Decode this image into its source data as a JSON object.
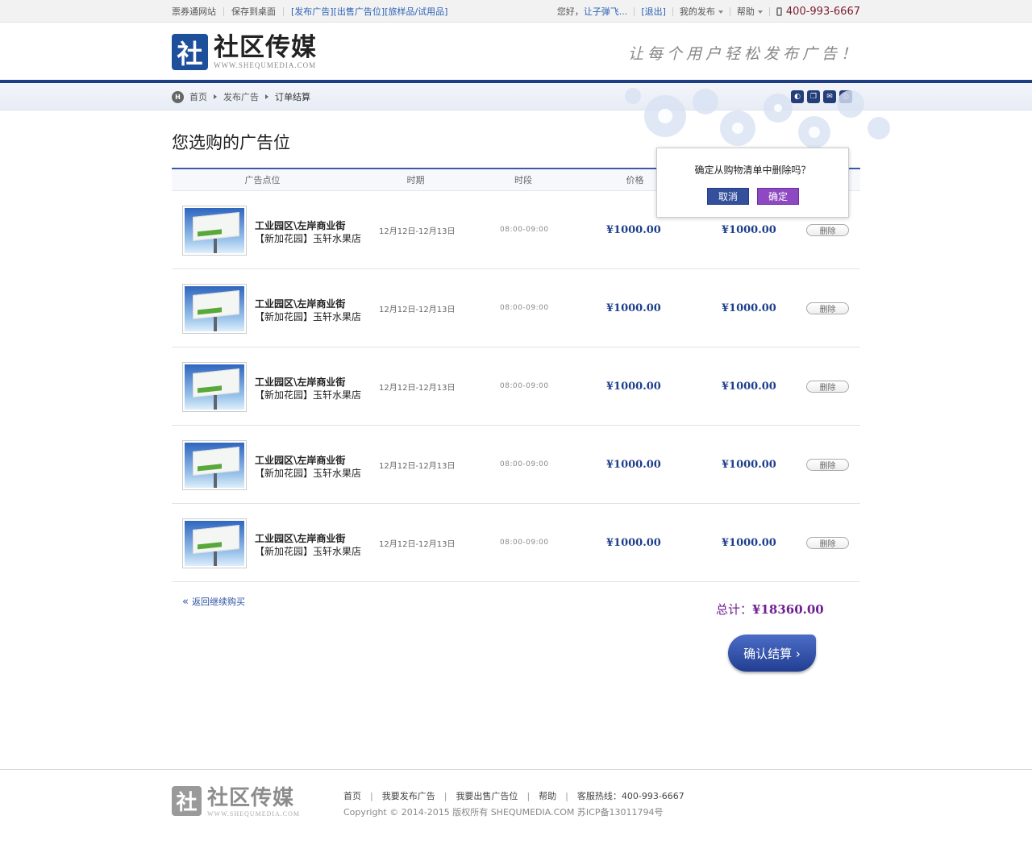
{
  "topbar": {
    "site_name": "票券通网站",
    "save_desktop": "保存到桌面",
    "links": [
      "[发布广告]",
      "[出售广告位]",
      "[旅样品/试用品]"
    ],
    "greeting": "您好，",
    "username": "让子弹飞...",
    "logout": "[退出]",
    "my_publish": "我的发布",
    "help": "帮助",
    "phone": "400-993-6667"
  },
  "header": {
    "logo_mark": "社",
    "logo_cn": "社区传媒",
    "logo_en": "WWW.SHEQUMEDIA.COM",
    "slogan": "让每个用户轻松发布广告！"
  },
  "breadcrumb": {
    "home_icon": "H",
    "items": [
      "首页",
      "发布广告",
      "订单结算"
    ],
    "share_icons": [
      "wechat-icon",
      "copy-icon",
      "mail-icon",
      "print-icon"
    ]
  },
  "page": {
    "title": "您选购的广告位"
  },
  "table": {
    "headers": [
      "广告点位",
      "时期",
      "时段",
      "价格"
    ],
    "rows": [
      {
        "name_line1": "工业园区\\左岸商业街",
        "name_line2": "【新加花园】玉轩水果店",
        "date": "12月12日-12月13日",
        "time": "08:00-09:00",
        "price": "¥1000.00",
        "subtotal": "¥1000.00",
        "delete": "删除"
      },
      {
        "name_line1": "工业园区\\左岸商业街",
        "name_line2": "【新加花园】玉轩水果店",
        "date": "12月12日-12月13日",
        "time": "08:00-09:00",
        "price": "¥1000.00",
        "subtotal": "¥1000.00",
        "delete": "删除"
      },
      {
        "name_line1": "工业园区\\左岸商业街",
        "name_line2": "【新加花园】玉轩水果店",
        "date": "12月12日-12月13日",
        "time": "08:00-09:00",
        "price": "¥1000.00",
        "subtotal": "¥1000.00",
        "delete": "删除"
      },
      {
        "name_line1": "工业园区\\左岸商业街",
        "name_line2": "【新加花园】玉轩水果店",
        "date": "12月12日-12月13日",
        "time": "08:00-09:00",
        "price": "¥1000.00",
        "subtotal": "¥1000.00",
        "delete": "删除"
      },
      {
        "name_line1": "工业园区\\左岸商业街",
        "name_line2": "【新加花园】玉轩水果店",
        "date": "12月12日-12月13日",
        "time": "08:00-09:00",
        "price": "¥1000.00",
        "subtotal": "¥1000.00",
        "delete": "删除"
      }
    ]
  },
  "summary": {
    "back_link": "返回继续购买",
    "total_label": "总计：",
    "total_value": "¥18360.00",
    "confirm_button": "确认结算 ›"
  },
  "popup": {
    "message": "确定从购物清单中删除吗？",
    "cancel": "取消",
    "ok": "确定"
  },
  "footer": {
    "logo_mark": "社",
    "logo_cn": "社区传媒",
    "logo_en": "WWW.SHEQUMEDIA.COM",
    "links": [
      "首页",
      "我要发布广告",
      "我要出售广告位",
      "帮助",
      "客服热线：400-993-6667"
    ],
    "copyright": "Copyright © 2014-2015 版权所有 SHEQUMEDIA.COM 苏ICP备13011794号"
  },
  "colors": {
    "brand_blue": "#1f3f84",
    "price_blue": "#1e3f8c",
    "total_purple": "#6e1f93",
    "ok_purple": "#8e48c2"
  }
}
